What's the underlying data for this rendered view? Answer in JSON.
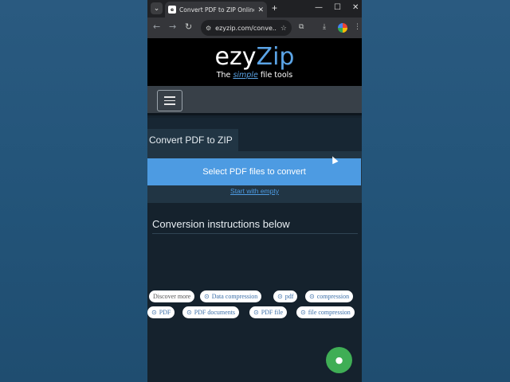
{
  "browser": {
    "tab_search_icon": "chevron-down",
    "tab_favicon": "e",
    "tab_title": "Convert PDF to ZIP Online. Qu",
    "tab_close": "✕",
    "new_tab": "+",
    "minimize": "—",
    "maximize": "☐",
    "close": "✕",
    "back": "←",
    "forward": "→",
    "reload": "↻",
    "site_info": "⚙",
    "url": "ezyzip.com/conve...",
    "bookmark": "☆",
    "extensions": "⧉",
    "download": "⤓",
    "menu": "⋮"
  },
  "header": {
    "logo_a": "ezy",
    "logo_b": "Zip",
    "tagline_a": "The ",
    "tagline_simple": "simple",
    "tagline_b": " file tools"
  },
  "converter": {
    "tab_label": "Convert PDF to ZIP",
    "select_label": "Select PDF files to convert",
    "start_empty": "Start with empty"
  },
  "instructions": {
    "heading": "Conversion instructions below"
  },
  "tags": {
    "discover": "Discover more",
    "items": [
      "Data compression",
      "pdf",
      "compression",
      "PDF",
      "PDF documents",
      "PDF file",
      "file compression"
    ]
  },
  "colors": {
    "accent": "#4d9be2",
    "chat": "#3fae55",
    "background": "#15222d"
  }
}
